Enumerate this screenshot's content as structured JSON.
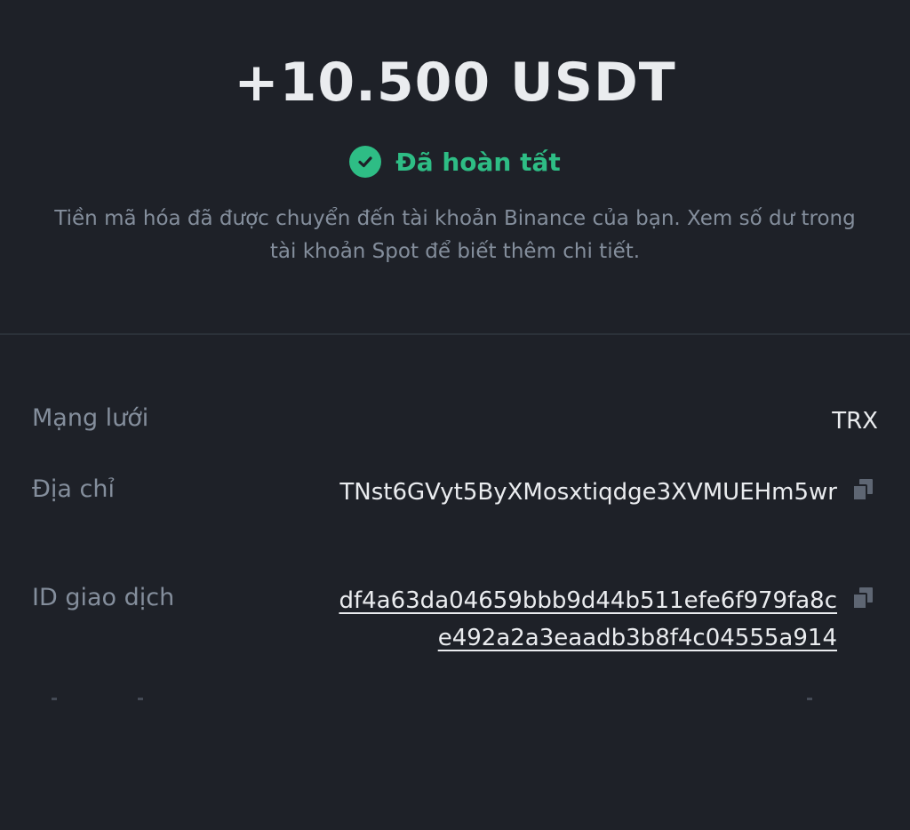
{
  "transaction": {
    "amount": "+10.500 USDT",
    "status_label": "Đã hoàn tất",
    "status_icon": "check-circle-icon",
    "description": "Tiền mã hóa đã được chuyển đến tài khoản Binance của bạn. Xem số dư trong tài khoản Spot để biết thêm chi tiết."
  },
  "details": {
    "network": {
      "label": "Mạng lưới",
      "value": "TRX"
    },
    "address": {
      "label": "Địa chỉ",
      "value": "TNst6GVyt5ByXMosxtiqdge3XVMUEHm5wr",
      "icon": "copy-icon"
    },
    "txid": {
      "label": "ID giao dịch",
      "value": "df4a63da04659bbb9d44b511efe6f979fa8ce492a2a3eaadb3b8f4c04555a914",
      "icon": "copy-icon"
    }
  },
  "colors": {
    "background": "#1e2128",
    "success": "#2ebd85",
    "muted": "#848e9c",
    "text": "#eaecef"
  }
}
